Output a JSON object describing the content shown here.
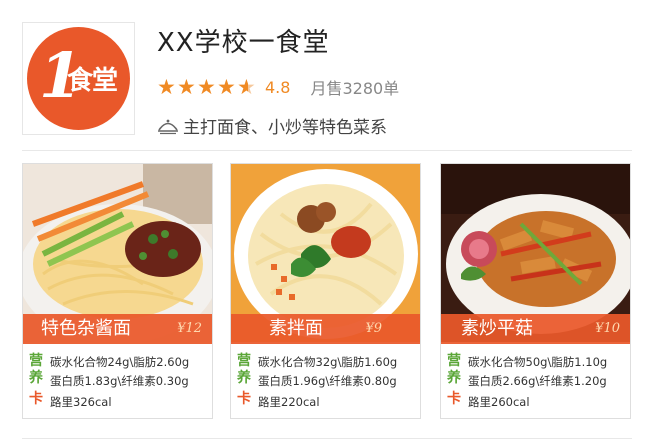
{
  "store": {
    "name": "XX学校一食堂",
    "logo_text": "食堂",
    "logo_numeral": "1",
    "rating": 4.5,
    "score_label": "4.8",
    "sales_label": "月售3280单",
    "tagline": "主打面食、小炒等特色菜系",
    "tag_icon": "dish-cover-icon"
  },
  "colors": {
    "accent": "#e9582a",
    "star": "#f08a24",
    "green": "#5aa637"
  },
  "nutrition_badges": {
    "ying": "营",
    "yang": "养",
    "ka": "卡"
  },
  "dishes": [
    {
      "name": "特色杂酱面",
      "price": "¥12",
      "line1": "碳水化合物24g\\脂肪2.60g",
      "line2": "蛋白质1.83g\\纤维素0.30g",
      "line3": "路里326cal"
    },
    {
      "name": "素拌面",
      "price": "¥9",
      "line1": "碳水化合物32g\\脂肪1.60g",
      "line2": "蛋白质1.96g\\纤维素0.80g",
      "line3": "路里220cal"
    },
    {
      "name": "素炒平菇",
      "price": "¥10",
      "line1": "碳水化合物50g\\脂肪1.10g",
      "line2": "蛋白质2.66g\\纤维素1.20g",
      "line3": "路里260cal"
    }
  ]
}
